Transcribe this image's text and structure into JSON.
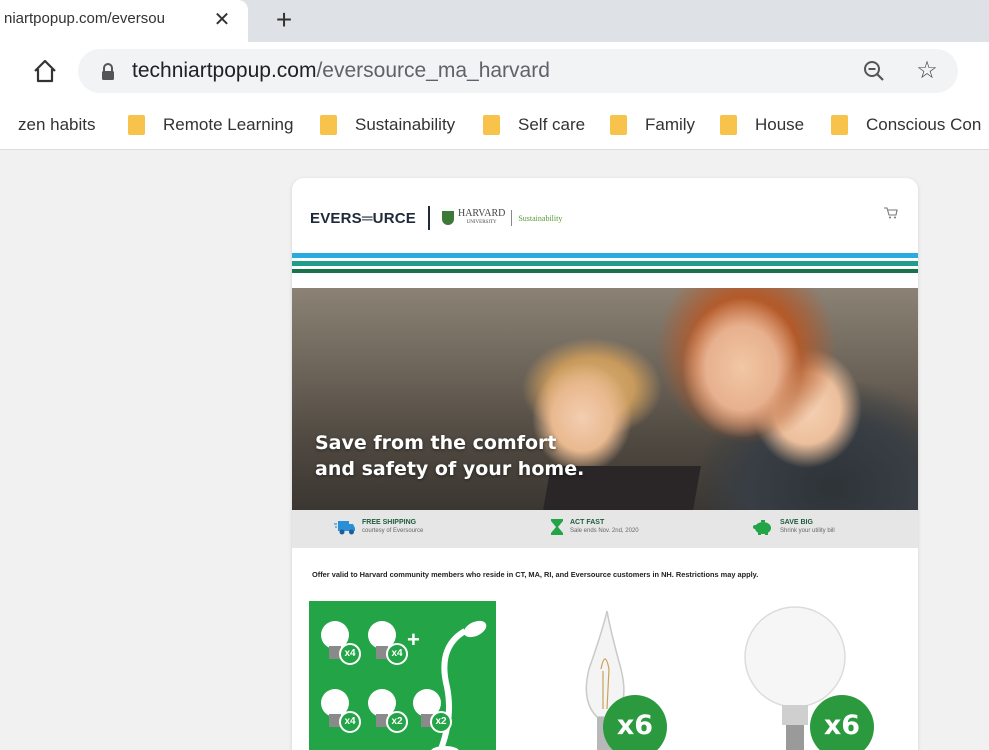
{
  "browser": {
    "tab_title": "niartpopup.com/eversou",
    "close_symbol": "✕",
    "newtab_symbol": "+",
    "url_domain": "techniartpopup.com",
    "url_path": "/eversource_ma_harvard",
    "star_symbol": "☆"
  },
  "bookmarks": [
    {
      "label": "zen habits",
      "icon": "none"
    },
    {
      "label": "Remote Learning",
      "icon": "folder-icon"
    },
    {
      "label": "Sustainability",
      "icon": "folder-icon"
    },
    {
      "label": "Self care",
      "icon": "folder-icon"
    },
    {
      "label": "Family",
      "icon": "folder-icon"
    },
    {
      "label": "House",
      "icon": "folder-icon"
    },
    {
      "label": "Conscious Con",
      "icon": "folder-icon"
    }
  ],
  "header": {
    "brand": "EVERS═URCE",
    "partner_line1": "HARVARD",
    "partner_line2": "UNIVERSITY",
    "partner_tag": "Sustainability"
  },
  "colors": {
    "stripe_blue": "#29aae1",
    "stripe_teal": "#1f9c8b",
    "stripe_green": "#19734a",
    "brand_green": "#22a447",
    "dark_green": "#1d5b3f",
    "folder_yellow": "#f7c34a"
  },
  "hero": {
    "line1": "Save from the comfort",
    "line2": "and safety of your home."
  },
  "benefits": [
    {
      "icon": "truck-icon",
      "title": "FREE SHIPPING",
      "subtitle": "courtesy of Eversource"
    },
    {
      "icon": "hourglass-icon",
      "title": "ACT FAST",
      "subtitle": "Sale ends Nov. 2nd, 2020"
    },
    {
      "icon": "piggy-bank-icon",
      "title": "SAVE BIG",
      "subtitle": "Shrink your utility bill"
    }
  ],
  "offer_text": "Offer valid to Harvard community members who reside in CT, MA, RI, and Eversource customers in NH. Restrictions may apply.",
  "products": [
    {
      "name": "bundle",
      "quantities": [
        "x4",
        "x4",
        "x4",
        "x2",
        "x2"
      ],
      "plus": "+"
    },
    {
      "name": "candelabra-filament",
      "quantity": "x6"
    },
    {
      "name": "globe",
      "quantity": "x6"
    }
  ]
}
